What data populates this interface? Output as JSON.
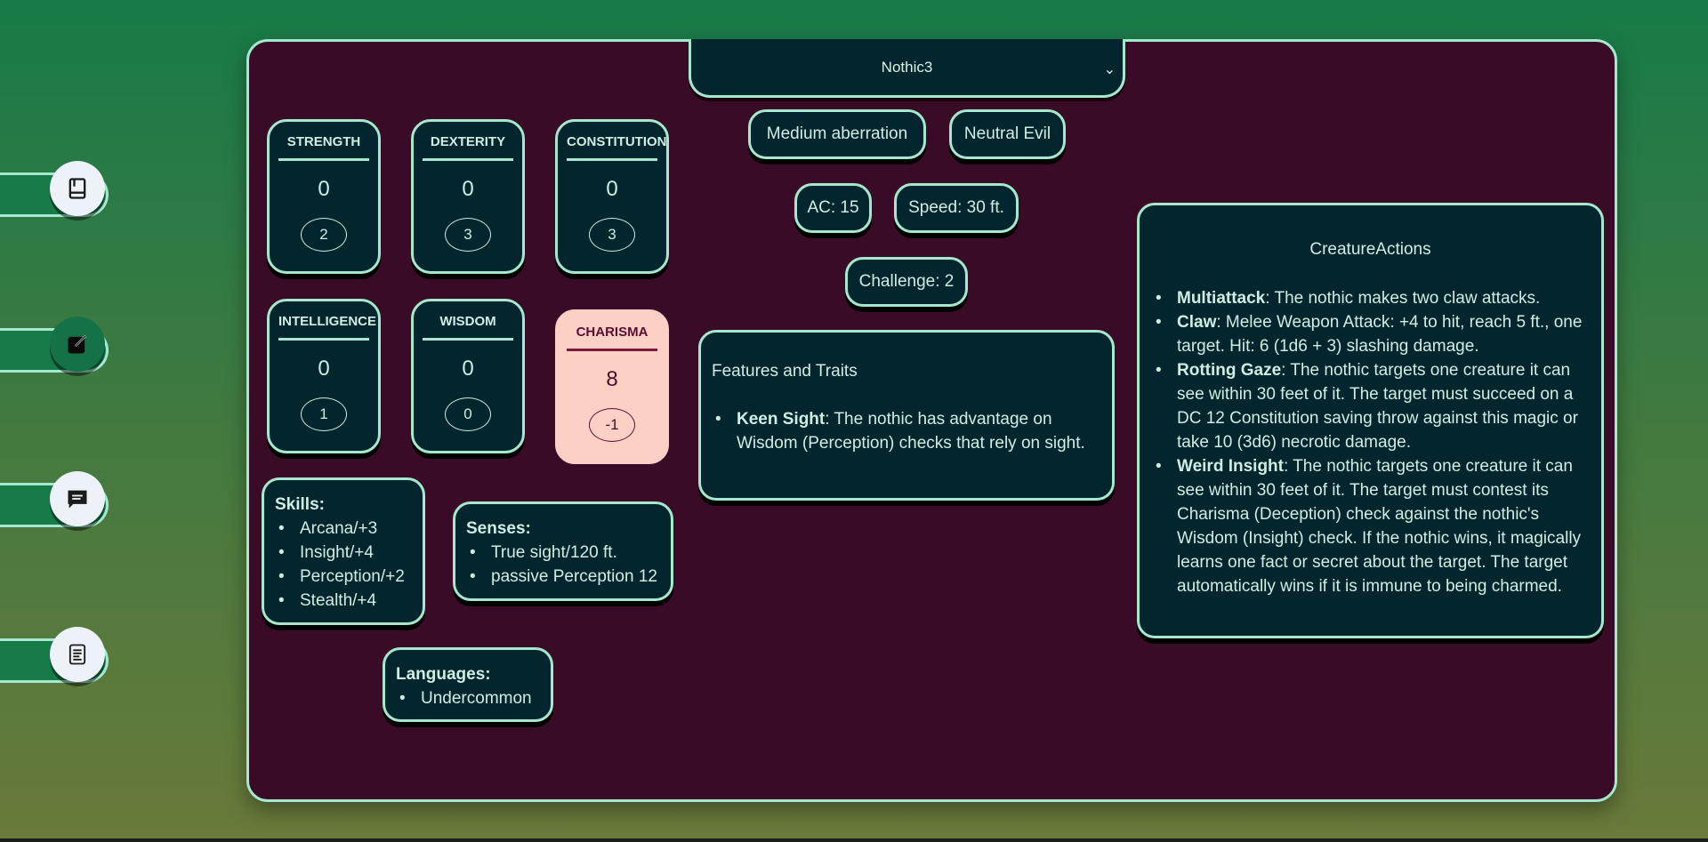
{
  "nav": {
    "items": [
      {
        "name": "book-icon",
        "active": false
      },
      {
        "name": "edit-icon",
        "active": true
      },
      {
        "name": "chat-icon",
        "active": false
      },
      {
        "name": "scroll-icon",
        "active": false
      }
    ]
  },
  "creature": {
    "selected": "Nothic3",
    "size_type": "Medium aberration",
    "alignment": "Neutral Evil",
    "ac": "AC: 15",
    "speed": "Speed: 30 ft.",
    "challenge": "Challenge: 2"
  },
  "stats": [
    {
      "name": "STRENGTH",
      "value": "0",
      "mod": "2"
    },
    {
      "name": "DEXTERITY",
      "value": "0",
      "mod": "3"
    },
    {
      "name": "CONSTITUTION",
      "value": "0",
      "mod": "3"
    },
    {
      "name": "INTELLIGENCE",
      "value": "0",
      "mod": "1"
    },
    {
      "name": "WISDOM",
      "value": "0",
      "mod": "0"
    },
    {
      "name": "CHARISMA",
      "value": "8",
      "mod": "-1"
    }
  ],
  "skills": {
    "title": "Skills:",
    "items": [
      "Arcana/+3",
      "Insight/+4",
      "Perception/+2",
      "Stealth/+4"
    ]
  },
  "senses": {
    "title": "Senses:",
    "items": [
      "True sight/120 ft.",
      "passive Perception 12"
    ]
  },
  "languages": {
    "title": "Languages:",
    "items": [
      "Undercommon"
    ]
  },
  "features": {
    "title": "Features and Traits",
    "items": [
      {
        "name": "Keen Sight",
        "text": ": The nothic has advantage on Wisdom (Perception) checks that rely on sight."
      }
    ]
  },
  "actions": {
    "title": "CreatureActions",
    "items": [
      {
        "name": "Multiattack",
        "text": ": The nothic makes two claw attacks."
      },
      {
        "name": "Claw",
        "text": ": Melee Weapon Attack: +4 to hit, reach 5 ft., one target. Hit: 6 (1d6 + 3) slashing damage."
      },
      {
        "name": "Rotting Gaze",
        "text": ": The nothic targets one creature it can see within 30 feet of it. The target must succeed on a DC 12 Constitution saving throw against this magic or take 10 (3d6) necrotic damage."
      },
      {
        "name": "Weird Insight",
        "text": ": The nothic targets one creature it can see within 30 feet of it. The target must contest its Charisma (Deception) check against the nothic's Wisdom (Insight) check. If the nothic wins, it magically learns one fact or secret about the target. The target automatically wins if it is immune to being charmed."
      }
    ]
  }
}
